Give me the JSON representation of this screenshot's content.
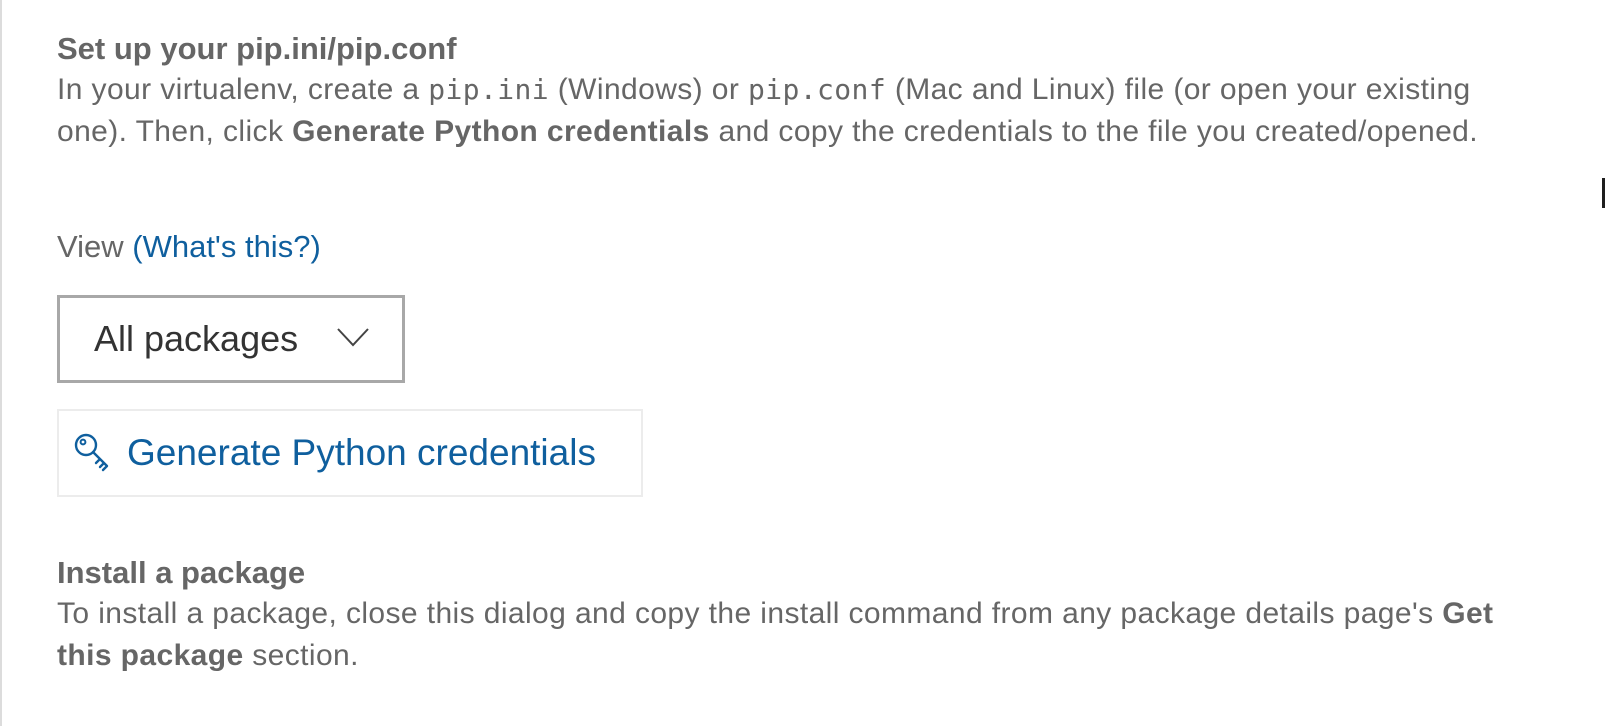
{
  "setup": {
    "title": "Set up your pip.ini/pip.conf",
    "p_in_your": "In your virtualenv, create a ",
    "p_pip_ini": "pip.ini",
    "p_windows_or": " (Windows) or ",
    "p_pip_conf": "pip.conf",
    "p_mac_linux": " (Mac and Linux) file (or open your existing one). Then, click ",
    "p_bold": "Generate Python credentials",
    "p_tail": " and copy the credentials to the file you created/opened."
  },
  "view": {
    "label": "View ",
    "help_link": "(What's this?)",
    "selected": "All packages",
    "icon": "chevron-down-icon"
  },
  "generate_button": {
    "label": "Generate Python credentials",
    "icon": "key-icon"
  },
  "install": {
    "title": "Install a package",
    "p_start": "To install a package, close this dialog and copy the install command from any package details page's ",
    "p_bold": "Get this package",
    "p_end": " section."
  },
  "colors": {
    "text": "#666666",
    "link": "#0f5f9e",
    "border": "#a8a8a8"
  }
}
